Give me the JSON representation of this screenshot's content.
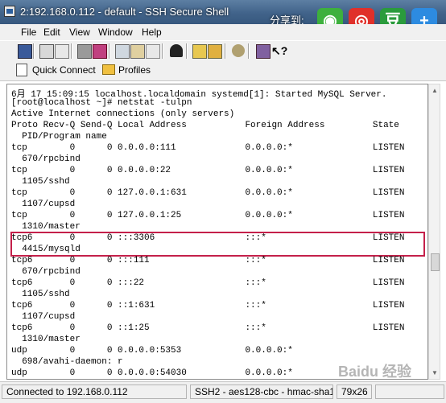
{
  "window": {
    "title": "2:192.168.0.112 - default - SSH Secure Shell"
  },
  "share": {
    "label": "分享到:",
    "buttons": [
      {
        "name": "wechat",
        "color": "#3db03d",
        "glyph": "◉"
      },
      {
        "name": "weibo",
        "color": "#e0302a",
        "glyph": "◎"
      },
      {
        "name": "douban",
        "color": "#2a9b3c",
        "glyph": "豆"
      },
      {
        "name": "more",
        "color": "#2d8be0",
        "glyph": "+"
      }
    ]
  },
  "menu": {
    "file": "File",
    "edit": "Edit",
    "view": "View",
    "window": "Window",
    "help": "Help"
  },
  "quickbar": {
    "quick_connect": "Quick Connect",
    "profiles": "Profiles"
  },
  "terminal": {
    "lines": [
      "6月 17 15:09:15 localhost.localdomain systemd[1]: Started MySQL Server.",
      "[root@localhost ~]# netstat -tulpn",
      "Active Internet connections (only servers)",
      "Proto Recv-Q Send-Q Local Address           Foreign Address         State",
      "  PID/Program name",
      "tcp        0      0 0.0.0.0:111             0.0.0.0:*               LISTEN",
      "  670/rpcbind",
      "tcp        0      0 0.0.0.0:22              0.0.0.0:*               LISTEN",
      "  1105/sshd",
      "tcp        0      0 127.0.0.1:631           0.0.0.0:*               LISTEN",
      "  1107/cupsd",
      "tcp        0      0 127.0.0.1:25            0.0.0.0:*               LISTEN",
      "  1310/master",
      "tcp6       0      0 :::3306                 :::*                    LISTEN",
      "  4415/mysqld",
      "tcp6       0      0 :::111                  :::*                    LISTEN",
      "  670/rpcbind",
      "tcp6       0      0 :::22                   :::*                    LISTEN",
      "  1105/sshd",
      "tcp6       0      0 ::1:631                 :::*                    LISTEN",
      "  1107/cupsd",
      "tcp6       0      0 ::1:25                  :::*                    LISTEN",
      "  1310/master",
      "udp        0      0 0.0.0.0:5353            0.0.0.0:*",
      "  698/avahi-daemon: r",
      "udp        0      0 0.0.0.0:54030           0.0.0.0:*"
    ]
  },
  "status": {
    "connected": "Connected to 192.168.0.112",
    "cipher": "SSH2 - aes128-cbc - hmac-sha1",
    "size": "79x26"
  },
  "watermark": "Baidu 经验"
}
